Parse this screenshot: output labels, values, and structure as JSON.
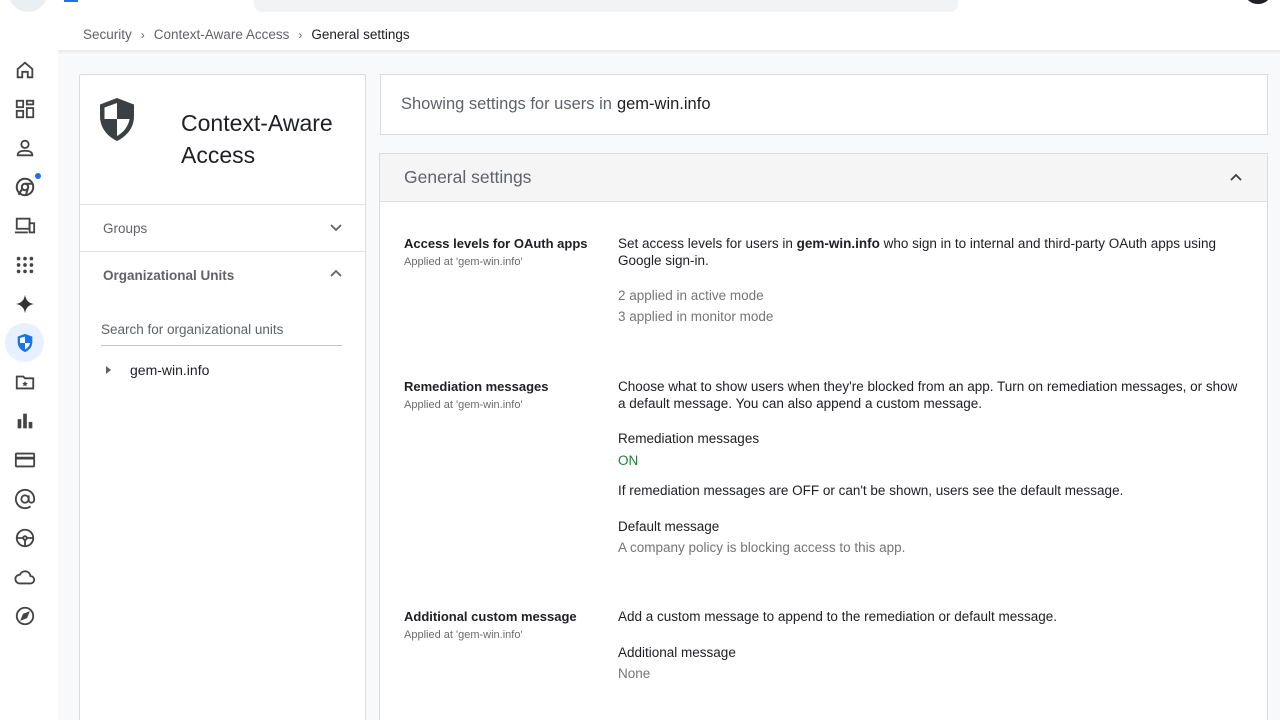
{
  "breadcrumb": {
    "items": [
      "Security",
      "Context-Aware Access"
    ],
    "current": "General settings",
    "separator": "›"
  },
  "rail": {
    "icons": [
      "home-icon",
      "dashboard-icon",
      "person-icon",
      "chrome-icon",
      "devices-icon",
      "apps-grid-icon",
      "sparkle-icon",
      "shield-icon",
      "folder-star-icon",
      "bar-chart-icon",
      "credit-card-icon",
      "at-sign-icon",
      "steering-wheel-icon",
      "cloud-icon",
      "compass-icon"
    ],
    "active_index": 7,
    "accent": "#1a73e8"
  },
  "left_panel": {
    "title": "Context-Aware Access",
    "sections": [
      {
        "label": "Groups",
        "expanded": false
      },
      {
        "label": "Organizational Units",
        "expanded": true
      }
    ],
    "search_placeholder": "Search for organizational units",
    "tree_root": "gem-win.info"
  },
  "scope": {
    "prefix": "Showing settings for users in",
    "domain": "gem-win.info"
  },
  "settings": {
    "title": "General settings",
    "rows": [
      {
        "title": "Access levels for OAuth apps",
        "applied": "Applied at 'gem-win.info'",
        "desc_pre": "Set access levels for users in",
        "desc_domain": "gem-win.info",
        "desc_post": "who sign in to internal and third-party OAuth apps using Google sign-in.",
        "active": "2 applied in active mode",
        "monitor": "3 applied in monitor mode"
      },
      {
        "title": "Remediation messages",
        "applied": "Applied at 'gem-win.info'",
        "desc": "Choose what to show users when they're blocked from an app. Turn on remediation messages, or show a default message. You can also append a custom message.",
        "field_label": "Remediation messages",
        "field_value": "ON",
        "note": "If remediation messages are OFF or can't be shown, users see the default message.",
        "default_label": "Default message",
        "default_value": "A company policy is blocking access to this app."
      },
      {
        "title": "Additional custom message",
        "applied": "Applied at 'gem-win.info'",
        "desc": "Add a custom message to append to the remediation or default message.",
        "field_label": "Additional message",
        "field_value": "None"
      }
    ]
  }
}
